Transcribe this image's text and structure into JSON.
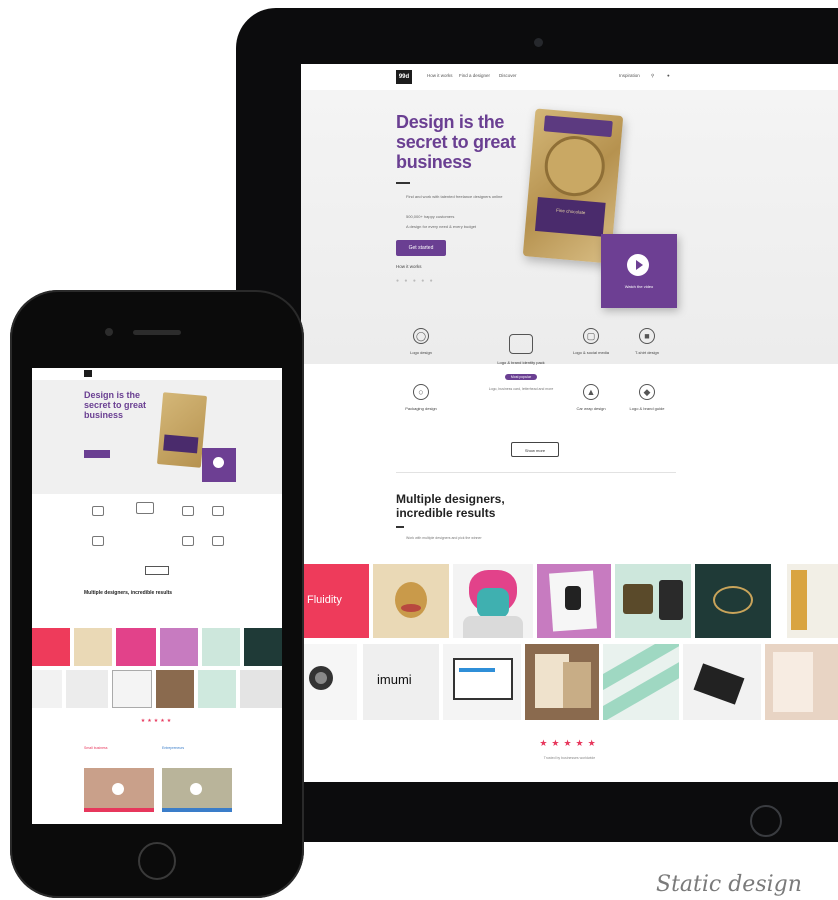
{
  "tablet": {
    "nav": {
      "logo": "99d",
      "links": [
        "How it works",
        "Find a designer",
        "Discover"
      ],
      "right": [
        "Inspiration",
        "Log in"
      ]
    },
    "hero": {
      "headline": "Design is the secret to great business",
      "subtitle": "Find and work with talented freelance designers online",
      "bullets": [
        "500,000+ happy customers",
        "A design for every need & every budget"
      ],
      "cta": "Get started",
      "link": "How it works"
    },
    "product": {
      "label": "Fine chocolate"
    },
    "video": {
      "label": "Watch the video"
    },
    "categories": [
      {
        "label": "Logo design",
        "icon": "logo-icon"
      },
      {
        "label": "Logo & social media",
        "icon": "social-icon"
      },
      {
        "label": "T-shirt design",
        "icon": "tshirt-icon"
      },
      {
        "label": "Packaging design",
        "icon": "package-icon"
      },
      {
        "label": "Car wrap design",
        "icon": "car-icon"
      },
      {
        "label": "Logo & brand guide",
        "icon": "guide-icon"
      }
    ],
    "featured": {
      "label": "Logo & brand identity pack",
      "pill": "Most popular",
      "description": "Logo, business card, letterhead and more"
    },
    "show_more": "Show more",
    "section_title": "Multiple designers, incredible results",
    "section_sub": "Work with multiple designers and pick the winner",
    "gallery_words": [
      "Fluidity",
      "imumi"
    ],
    "stars": "★★★★★",
    "caption": "Trusted by businesses worldwide"
  },
  "phone": {
    "headline": "Design is the secret to great business",
    "section_title": "Multiple designers, incredible results",
    "stars": "★★★★★",
    "tabs": [
      "Small business",
      "Entrepreneurs"
    ]
  },
  "footer": {
    "text": "Static design"
  }
}
